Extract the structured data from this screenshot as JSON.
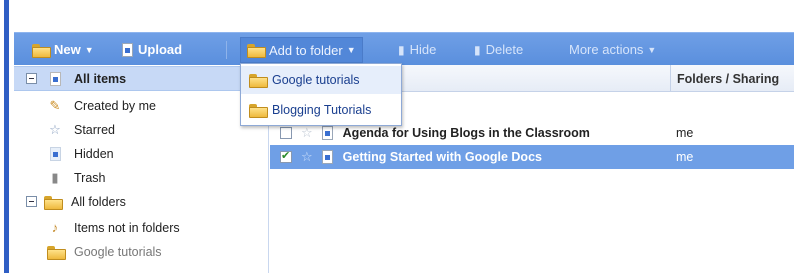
{
  "toolbar": {
    "new_label": "New",
    "upload_label": "Upload",
    "add_to_folder_label": "Add to folder",
    "hide_label": "Hide",
    "delete_label": "Delete",
    "more_actions_label": "More actions"
  },
  "dropdown": {
    "items": [
      {
        "label": "Google tutorials"
      },
      {
        "label": "Blogging Tutorials"
      }
    ]
  },
  "sidebar": {
    "items": [
      {
        "label": "All items"
      },
      {
        "label": "Created by me"
      },
      {
        "label": "Starred"
      },
      {
        "label": "Hidden"
      },
      {
        "label": "Trash"
      },
      {
        "label": "All folders"
      },
      {
        "label": "Items not in folders"
      },
      {
        "label": "Google tutorials"
      }
    ]
  },
  "table": {
    "sharing_header": "Folders / Sharing",
    "rows": [
      {
        "title": "Agenda for Using Blogs in the Classroom",
        "sharing": "me",
        "checked": false
      },
      {
        "title": "Getting Started with Google Docs",
        "sharing": "me",
        "checked": true
      }
    ]
  },
  "colors": {
    "toolbar": "#6f9fe6",
    "selection": "#6f9fe6",
    "sidebar_selected": "#c7d9f6"
  }
}
